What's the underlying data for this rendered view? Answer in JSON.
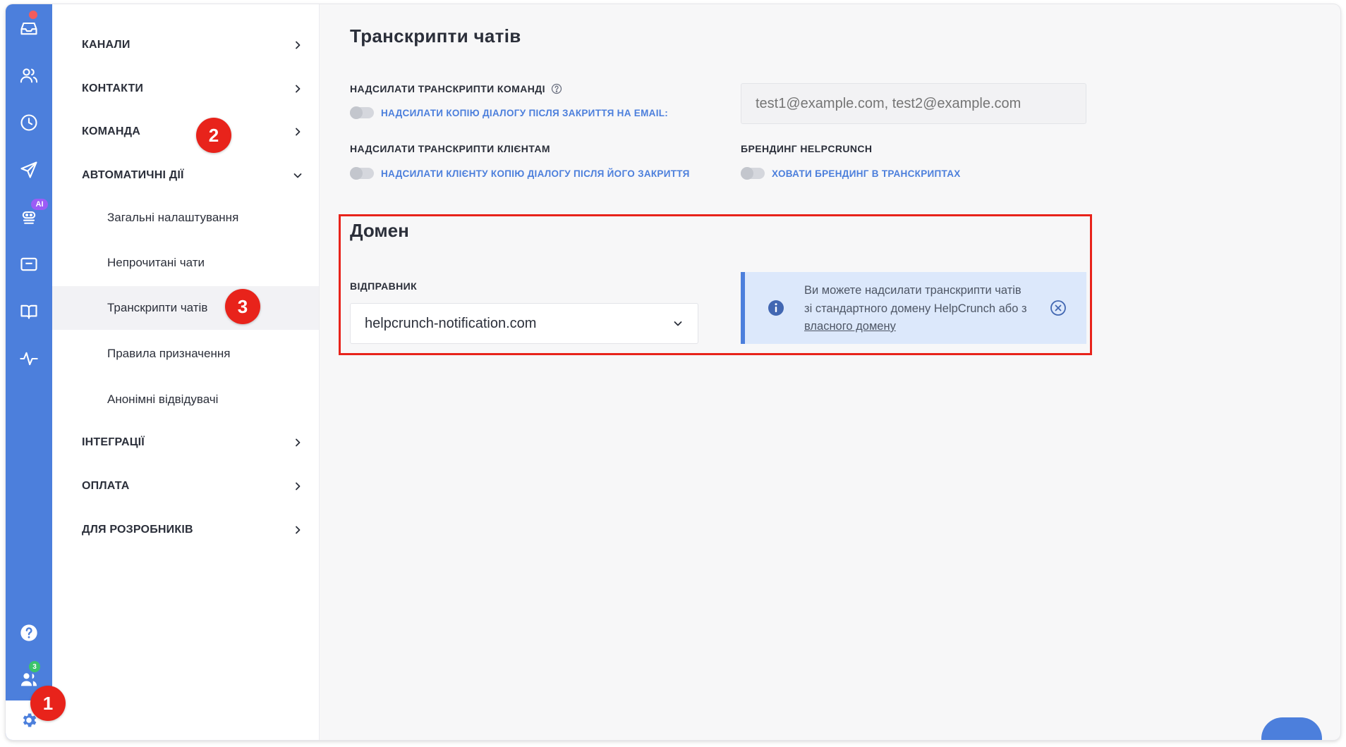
{
  "rail": {
    "items": [
      {
        "name": "inbox",
        "icon": "inbox-icon"
      },
      {
        "name": "contacts",
        "icon": "users-icon"
      },
      {
        "name": "history",
        "icon": "clock-icon"
      },
      {
        "name": "campaigns",
        "icon": "send-icon"
      },
      {
        "name": "ai-bot",
        "icon": "bot-icon",
        "badge": "AI"
      },
      {
        "name": "popups",
        "icon": "window-icon"
      },
      {
        "name": "knowledge-base",
        "icon": "book-icon"
      },
      {
        "name": "activity",
        "icon": "pulse-icon"
      }
    ],
    "bottom": [
      {
        "name": "help",
        "icon": "help-icon"
      },
      {
        "name": "team-online",
        "icon": "team-icon",
        "badge": "3"
      },
      {
        "name": "settings",
        "icon": "gear-icon"
      }
    ]
  },
  "menu": {
    "channels": "КАНАЛИ",
    "contacts": "КОНТАКТИ",
    "team": "КОМАНДА",
    "automation": "АВТОМАТИЧНІ ДІЇ",
    "sub": {
      "general": "Загальні налаштування",
      "unread": "Непрочитані чати",
      "transcripts": "Транскрипти чатів",
      "assignment": "Правила призначення",
      "anonymous": "Анонімні відвідувачі"
    },
    "integrations": "ІНТЕГРАЦІЇ",
    "billing": "ОПЛАТА",
    "developers": "ДЛЯ РОЗРОБНИКІВ"
  },
  "steps": {
    "one": "1",
    "two": "2",
    "three": "3"
  },
  "main": {
    "title": "Транскрипти чатів",
    "team_transcripts": {
      "label": "НАДСИЛАТИ ТРАНСКРИПТИ КОМАНДІ",
      "toggle_text": "НАДСИЛАТИ КОПІЮ ДІАЛОГУ ПІСЛЯ ЗАКРИТТЯ НА EMAIL:",
      "email_placeholder": "test1@example.com, test2@example.com"
    },
    "client_transcripts": {
      "label": "НАДСИЛАТИ ТРАНСКРИПТИ КЛІЄНТАМ",
      "toggle_text": "НАДСИЛАТИ КЛІЄНТУ КОПІЮ ДІАЛОГУ ПІСЛЯ ЙОГО ЗАКРИТТЯ"
    },
    "branding": {
      "label": "БРЕНДИНГ HELPCRUNCH",
      "toggle_text": "ХОВАТИ БРЕНДИНГ В ТРАНСКРИПТАХ"
    },
    "domain": {
      "title": "Домен",
      "sender_label": "ВІДПРАВНИК",
      "sender_value": "helpcrunch-notification.com",
      "info_text": "Ви можете надсилати транскрипти чатів зі стандартного домену HelpCrunch або з ",
      "info_link": "власного домену"
    }
  },
  "colors": {
    "rail": "#4c7fdc",
    "accent": "#4c7fdc",
    "step": "#e8231b",
    "info_bg": "#dce8fb"
  }
}
